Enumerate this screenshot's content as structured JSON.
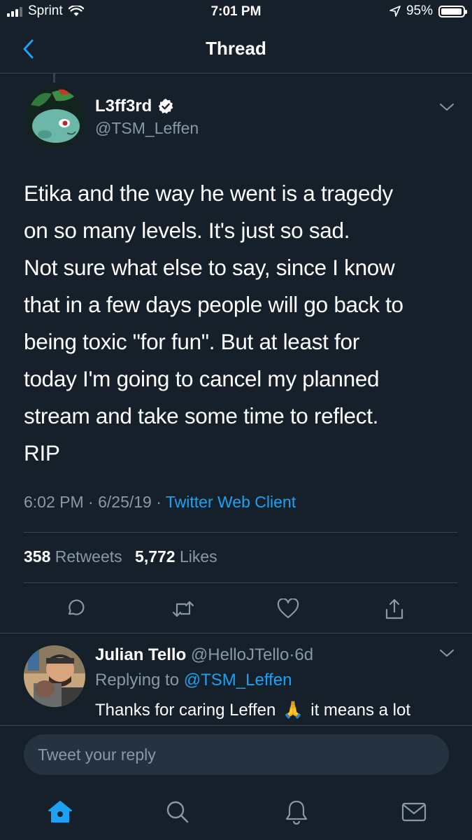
{
  "status_bar": {
    "carrier": "Sprint",
    "time": "7:01 PM",
    "battery": "95%",
    "battery_level": 0.95
  },
  "nav": {
    "title": "Thread",
    "accent_color": "#1da1f2"
  },
  "tweet": {
    "display_name": "L3ff3rd",
    "handle": "@TSM_Leffen",
    "verified": true,
    "text_lines": [
      "Etika and the way he went is a tragedy",
      "on so many levels. It's just so sad.",
      "Not sure what else to say, since I know",
      "that in a few days people will go back to",
      "being toxic \"for fun\". But at least for",
      "today I'm going to cancel my planned",
      "stream and take some time to reflect.",
      "RIP"
    ],
    "time": "6:02 PM",
    "date": "6/25/19",
    "separator": "·",
    "source": "Twitter Web Client",
    "retweets_count": "358",
    "retweets_label": "Retweets",
    "likes_count": "5,772",
    "likes_label": "Likes"
  },
  "reply": {
    "display_name": "Julian Tello",
    "handle": "@HelloJTello",
    "age": "6d",
    "separator": "·",
    "replying_to_label": "Replying to",
    "replying_to_handle": "@TSM_Leffen",
    "text_before": "Thanks for caring Leffen",
    "emoji": "🙏",
    "text_after": "it means a lot"
  },
  "composer": {
    "placeholder": "Tweet your reply"
  },
  "tab_bar": {
    "items": [
      {
        "icon": "home-icon",
        "active": true
      },
      {
        "icon": "search-icon",
        "active": false
      },
      {
        "icon": "notifications-icon",
        "active": false
      },
      {
        "icon": "messages-icon",
        "active": false
      }
    ]
  },
  "colors": {
    "background": "#15202b",
    "divider": "#38444d",
    "secondary_text": "#8899a6",
    "link": "#1da1f2"
  }
}
